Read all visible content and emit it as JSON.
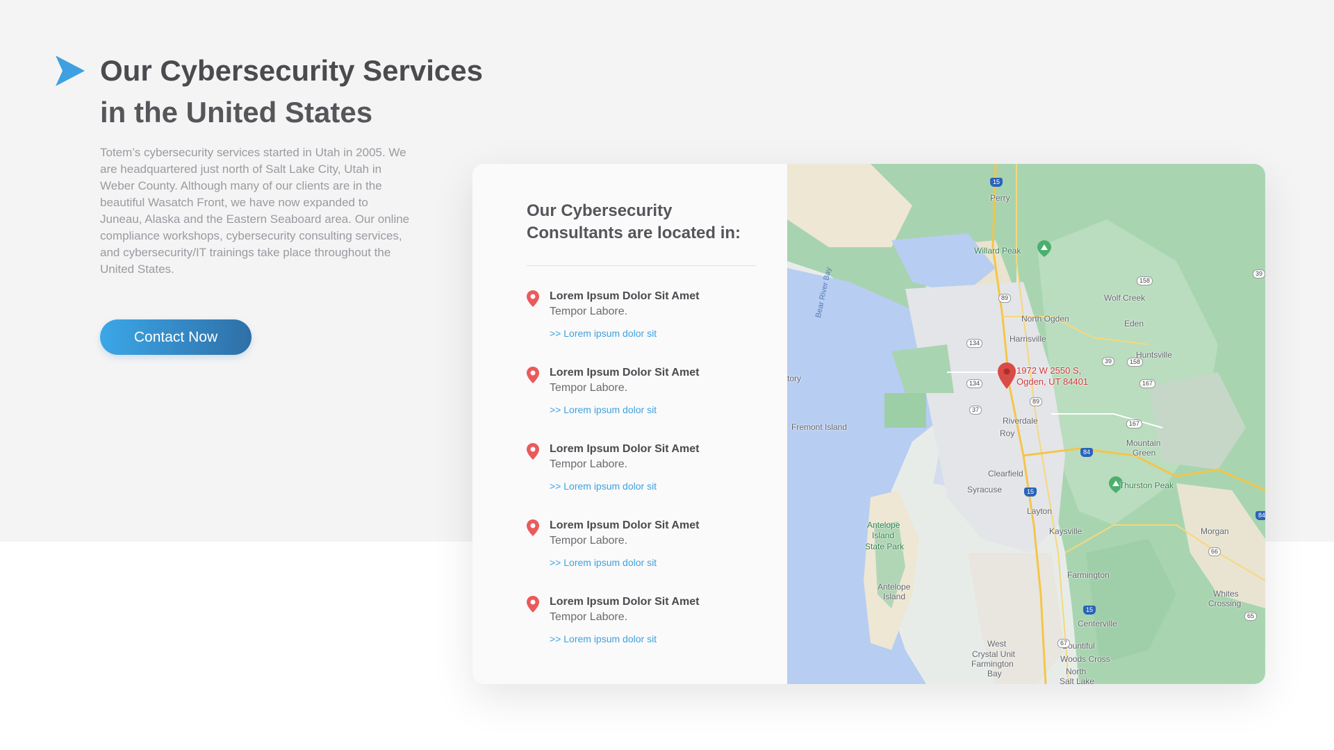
{
  "hero": {
    "title_strong": "Our Cybersecurity Services",
    "title_light": "in the United States",
    "intro": "Totem’s cybersecurity services started in Utah in 2005. We are headquartered just north of Salt Lake City, Utah in Weber County.  Although many of our clients are in the beautiful Wasatch Front, we have now expanded to Juneau, Alaska and the Eastern Seaboard area. Our online compliance workshops, cybersecurity consulting services, and cybersecurity/IT trainings take place throughout the United States.",
    "cta_label": "Contact Now"
  },
  "card": {
    "heading": "Our Cybersecurity Consultants are located in:",
    "locations": [
      {
        "name": "Lorem Ipsum Dolor Sit Amet",
        "sub": "Tempor Labore.",
        "link": ">> Lorem ipsum dolor sit"
      },
      {
        "name": "Lorem Ipsum Dolor Sit Amet",
        "sub": "Tempor Labore.",
        "link": ">> Lorem ipsum dolor sit"
      },
      {
        "name": "Lorem Ipsum Dolor Sit Amet",
        "sub": "Tempor Labore.",
        "link": ">> Lorem ipsum dolor sit"
      },
      {
        "name": "Lorem Ipsum Dolor Sit Amet",
        "sub": "Tempor Labore.",
        "link": ">> Lorem ipsum dolor sit"
      },
      {
        "name": "Lorem Ipsum Dolor Sit Amet",
        "sub": "Tempor Labore.",
        "link": ">> Lorem ipsum dolor sit"
      }
    ]
  },
  "map": {
    "address_line1": "1972 W 2550 S,",
    "address_line2": "Ogden, UT 84401",
    "places": {
      "perry": "Perry",
      "willard_peak": "Willard Peak",
      "wolf_creek": "Wolf Creek",
      "north_ogden": "North Ogden",
      "eden": "Eden",
      "harrisville": "Harrisville",
      "huntsville": "Huntsville",
      "riverdale": "Riverdale",
      "roy": "Roy",
      "mountain_green_1": "Mountain",
      "mountain_green_2": "Green",
      "clearfield": "Clearfield",
      "syracuse": "Syracuse",
      "thurston_peak": "Thurston Peak",
      "layton": "Layton",
      "kaysville": "Kaysville",
      "morgan": "Morgan",
      "farmington": "Farmington",
      "whites_crossing_1": "Whites",
      "whites_crossing_2": "Crossing",
      "centerville": "Centerville",
      "bountiful": "Bountiful",
      "woods_cross": "Woods Cross",
      "north_salt_lake_1": "North",
      "north_salt_lake_2": "Salt Lake",
      "west_crystal_1": "West",
      "west_crystal_2": "Crystal Unit",
      "west_crystal_3": "Farmington",
      "west_crystal_4": "Bay",
      "fremont_island": "Fremont Island",
      "antelope_park_1": "Antelope",
      "antelope_park_2": "Island",
      "antelope_park_3": "State Park",
      "antelope_island_1": "Antelope",
      "antelope_island_2": "Island",
      "bear_river_bay": "Bear River Bay",
      "tory": "tory"
    },
    "shields": {
      "i15_top": "15",
      "us89_a": "89",
      "sr134_a": "134",
      "sr134_b": "134",
      "sr158": "158",
      "sr39": "39",
      "sr37": "37",
      "sr167_a": "167",
      "sr167_b": "167",
      "i84": "84",
      "i15_mid": "15",
      "sr66": "66",
      "i15_low": "15",
      "sr67": "67",
      "sr65": "65",
      "i84_edge": "84",
      "sr39_edge": "39",
      "sr158_b": "158",
      "us89_b": "89"
    }
  },
  "colors": {
    "accent": "#3ea0e0",
    "pin": "#ea5a5c",
    "title": "#4a4a4f"
  }
}
